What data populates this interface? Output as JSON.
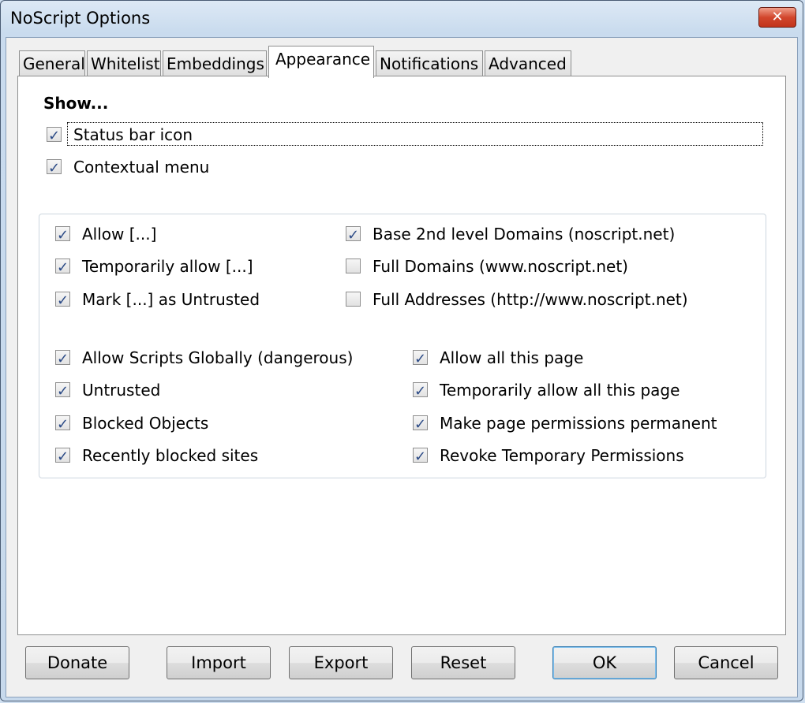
{
  "window": {
    "title": "NoScript Options",
    "close_label": "✕"
  },
  "tabs": [
    {
      "label": "General",
      "active": false
    },
    {
      "label": "Whitelist",
      "active": false
    },
    {
      "label": "Embeddings",
      "active": false
    },
    {
      "label": "Appearance",
      "active": true
    },
    {
      "label": "Notifications",
      "active": false
    },
    {
      "label": "Advanced",
      "active": false
    }
  ],
  "show": {
    "heading": "Show...",
    "items": [
      {
        "label": "Status bar icon",
        "checked": true
      },
      {
        "label": "Contextual menu",
        "checked": true
      }
    ]
  },
  "menu_items": {
    "left_top": [
      {
        "label": "Allow [...]",
        "checked": true
      },
      {
        "label": "Temporarily allow [...]",
        "checked": true
      },
      {
        "label": "Mark [...] as Untrusted",
        "checked": true
      }
    ],
    "right_top": [
      {
        "label": "Base 2nd level Domains (noscript.net)",
        "checked": true
      },
      {
        "label": "Full Domains (www.noscript.net)",
        "checked": false
      },
      {
        "label": "Full Addresses (http://www.noscript.net)",
        "checked": false
      }
    ],
    "left_bottom": [
      {
        "label": "Allow Scripts Globally (dangerous)",
        "checked": true
      },
      {
        "label": "Untrusted",
        "checked": true
      },
      {
        "label": "Blocked Objects",
        "checked": true
      },
      {
        "label": "Recently blocked sites",
        "checked": true
      }
    ],
    "right_bottom": [
      {
        "label": "Allow all this page",
        "checked": true
      },
      {
        "label": "Temporarily allow all this page",
        "checked": true
      },
      {
        "label": "Make page permissions permanent",
        "checked": true
      },
      {
        "label": "Revoke Temporary Permissions",
        "checked": true
      }
    ]
  },
  "buttons": {
    "donate": "Donate",
    "import": "Import",
    "export": "Export",
    "reset": "Reset",
    "ok": "OK",
    "cancel": "Cancel"
  }
}
